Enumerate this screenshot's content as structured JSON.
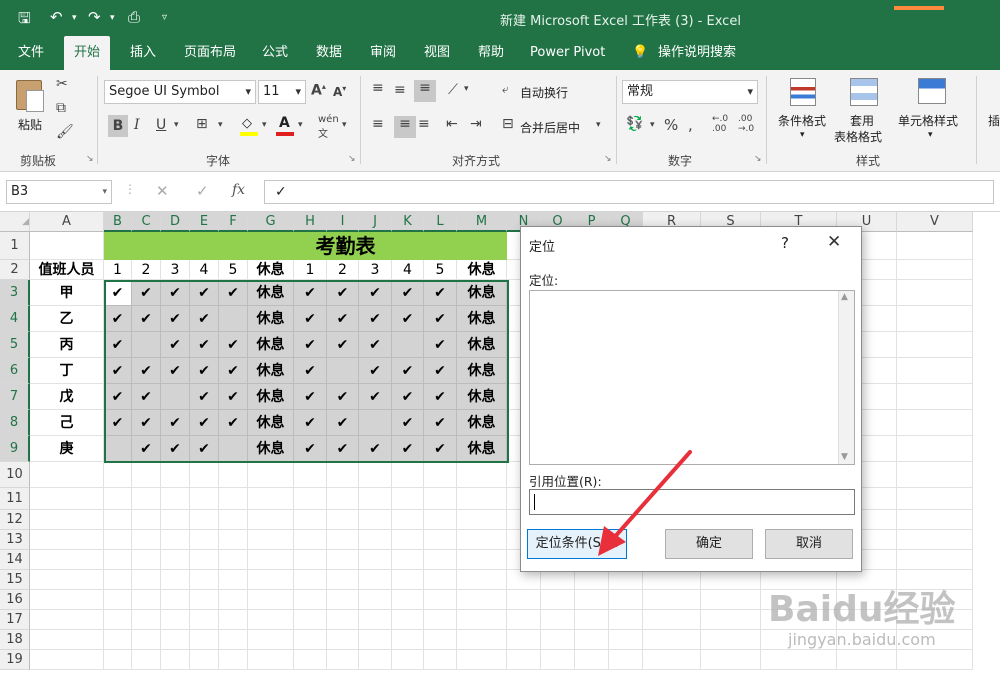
{
  "titlebar": {
    "title": "新建 Microsoft Excel 工作表 (3)  -  Excel"
  },
  "tabs": [
    {
      "label": "文件"
    },
    {
      "label": "开始"
    },
    {
      "label": "插入"
    },
    {
      "label": "页面布局"
    },
    {
      "label": "公式"
    },
    {
      "label": "数据"
    },
    {
      "label": "审阅"
    },
    {
      "label": "视图"
    },
    {
      "label": "帮助"
    },
    {
      "label": "Power Pivot"
    },
    {
      "label": "操作说明搜索"
    }
  ],
  "ribbon": {
    "paste": "粘贴",
    "font_name": "Segoe UI Symbol",
    "font_size": "11",
    "bold": "B",
    "italic": "I",
    "underline": "U",
    "wrap_text": "自动换行",
    "merge_center": "合并后居中",
    "number_format": "常规",
    "cond_format": "条件格式",
    "table_format_1": "套用",
    "table_format_2": "表格格式",
    "cell_styles": "单元格样式",
    "insert_partial": "插",
    "groups": {
      "clipboard": "剪贴板",
      "font": "字体",
      "alignment": "对齐方式",
      "number": "数字",
      "styles": "样式"
    }
  },
  "formula_bar": {
    "name_box": "B3",
    "fx": "fx",
    "content": "✓"
  },
  "sheet": {
    "columns": [
      "A",
      "B",
      "C",
      "D",
      "E",
      "F",
      "G",
      "H",
      "I",
      "J",
      "K",
      "L",
      "M",
      "N",
      "O",
      "P",
      "Q",
      "R",
      "S",
      "T",
      "U",
      "V"
    ],
    "rows": [
      "1",
      "2",
      "3",
      "4",
      "5",
      "6",
      "7",
      "8",
      "9",
      "10",
      "11",
      "12",
      "13",
      "14",
      "15",
      "16",
      "17",
      "18",
      "19"
    ],
    "title": "考勤表",
    "header_row": [
      "值班人员",
      "1",
      "2",
      "3",
      "4",
      "5",
      "休息",
      "1",
      "2",
      "3",
      "4",
      "5",
      "休息"
    ],
    "data_rows": [
      [
        "甲",
        "✔",
        "✔",
        "✔",
        "✔",
        "✔",
        "休息",
        "✔",
        "✔",
        "✔",
        "✔",
        "✔",
        "休息"
      ],
      [
        "乙",
        "✔",
        "✔",
        "✔",
        "✔",
        "",
        "休息",
        "✔",
        "✔",
        "✔",
        "✔",
        "✔",
        "休息"
      ],
      [
        "丙",
        "✔",
        "",
        "✔",
        "✔",
        "✔",
        "休息",
        "✔",
        "✔",
        "✔",
        "",
        "✔",
        "休息"
      ],
      [
        "丁",
        "✔",
        "✔",
        "✔",
        "✔",
        "✔",
        "休息",
        "✔",
        "",
        "✔",
        "✔",
        "✔",
        "休息"
      ],
      [
        "戊",
        "✔",
        "✔",
        "",
        "✔",
        "✔",
        "休息",
        "✔",
        "✔",
        "✔",
        "✔",
        "✔",
        "休息"
      ],
      [
        "己",
        "✔",
        "✔",
        "✔",
        "✔",
        "✔",
        "休息",
        "✔",
        "✔",
        "",
        "✔",
        "✔",
        "休息"
      ],
      [
        "庚",
        "",
        "✔",
        "✔",
        "✔",
        "",
        "休息",
        "✔",
        "✔",
        "✔",
        "✔",
        "✔",
        "休息"
      ]
    ]
  },
  "dialog": {
    "title": "定位",
    "help": "?",
    "close": "✕",
    "goto_label": "定位:",
    "reference_label": "引用位置(R):",
    "reference_value": "",
    "special_button": "定位条件(S)...",
    "ok_button": "确定",
    "cancel_button": "取消"
  },
  "watermark": {
    "brand": "Baidu经验",
    "url": "jingyan.baidu.com"
  },
  "colors": {
    "excel_green": "#217346",
    "title_fill": "#92d050",
    "selection_fill": "#d3d3d3",
    "arrow": "#e8303a"
  }
}
